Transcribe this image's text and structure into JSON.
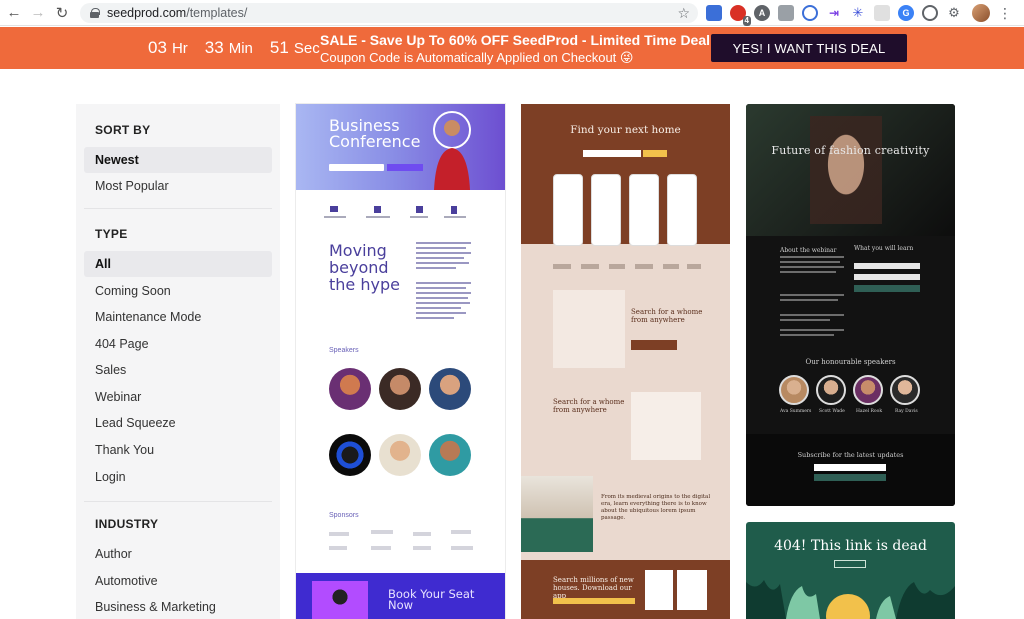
{
  "browser": {
    "url_domain": "seedprod.com",
    "url_path": "/templates/",
    "extension_badge": "4"
  },
  "promo": {
    "timer": {
      "hours": "03",
      "hours_unit": "Hr",
      "minutes": "33",
      "minutes_unit": "Min",
      "seconds": "51",
      "seconds_unit": "Sec"
    },
    "title": "SALE - Save Up To 60% OFF SeedProd - Limited Time Deal!",
    "subtitle": "Coupon Code is Automatically Applied on Checkout 😜",
    "cta": "YES! I WANT THIS DEAL",
    "color": "#ef6a3b"
  },
  "sidebar": {
    "sort_heading": "SORT BY",
    "sort_items": [
      {
        "label": "Newest",
        "active": true
      },
      {
        "label": "Most Popular",
        "active": false
      }
    ],
    "type_heading": "TYPE",
    "type_items": [
      {
        "label": "All",
        "active": true
      },
      {
        "label": "Coming Soon",
        "active": false
      },
      {
        "label": "Maintenance Mode",
        "active": false
      },
      {
        "label": "404 Page",
        "active": false
      },
      {
        "label": "Sales",
        "active": false
      },
      {
        "label": "Webinar",
        "active": false
      },
      {
        "label": "Lead Squeeze",
        "active": false
      },
      {
        "label": "Thank You",
        "active": false
      },
      {
        "label": "Login",
        "active": false
      }
    ],
    "industry_heading": "INDUSTRY",
    "industry_items": [
      {
        "label": "Author"
      },
      {
        "label": "Automotive"
      },
      {
        "label": "Business & Marketing"
      }
    ]
  },
  "templates": {
    "card1": {
      "hero_title_line1": "Business",
      "hero_title_line2": "Conference",
      "section_title_line1": "Moving",
      "section_title_line2": "beyond",
      "section_title_line3": "the hype",
      "speakers_label": "Speakers",
      "sponsors_label": "Sponsors",
      "banner_line1": "Book Your Seat",
      "banner_line2": "Now"
    },
    "card2": {
      "hero_title": "Find your next home",
      "section1_title": "Search for a whome from anywhere",
      "section2_title": "Search for a whome from anywhere",
      "quote": "From its medieval origins to the digital era, learn everything there is to know about the ubiquitous lorem ipsum passage.",
      "footer_title": "Search millions of new houses. Download our app"
    },
    "card3": {
      "hero_title": "Future of fashion creativity",
      "about_label": "About the webinar",
      "what_label": "What you will learn",
      "speakers_label": "Our honourable speakers",
      "speaker_names": [
        "Ava Summers",
        "Scott Wade",
        "Hazel Rook",
        "Ray Davis"
      ],
      "subscribe_label": "Subscribe for the latest updates"
    },
    "card4": {
      "title": "404! This link is dead"
    }
  }
}
